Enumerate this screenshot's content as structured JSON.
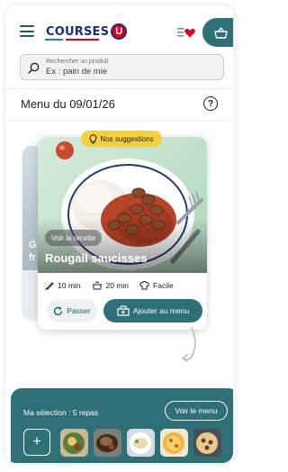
{
  "header": {
    "logo_text": "COURSES",
    "logo_u": "U",
    "menu_icon": "hamburger-menu-icon",
    "favorites_icon": "heart-list-icon",
    "cart_icon": "basket-icon",
    "brand_color": "#2f6f78"
  },
  "search": {
    "label": "Rechercher un produit",
    "placeholder": "Ex : pain de mie"
  },
  "menu": {
    "title": "Menu du 09/01/26",
    "help_icon": "?"
  },
  "back_card": {
    "text_line1": "G",
    "text_line2": "fr"
  },
  "card": {
    "badge": "Nos suggestions",
    "recipe_chip": "Voir la recette",
    "title": "Rougail saucisses",
    "prep_time": "10 min",
    "cook_time": "20 min",
    "difficulty": "Facile",
    "skip_label": "Passer",
    "add_label": "Ajouter au menu"
  },
  "selection": {
    "label": "Ma sélection : 5 repas",
    "button": "Voir le menu",
    "add_symbol": "+",
    "thumbnails": [
      "meal-1",
      "meal-2",
      "meal-3",
      "meal-4",
      "meal-5"
    ]
  }
}
